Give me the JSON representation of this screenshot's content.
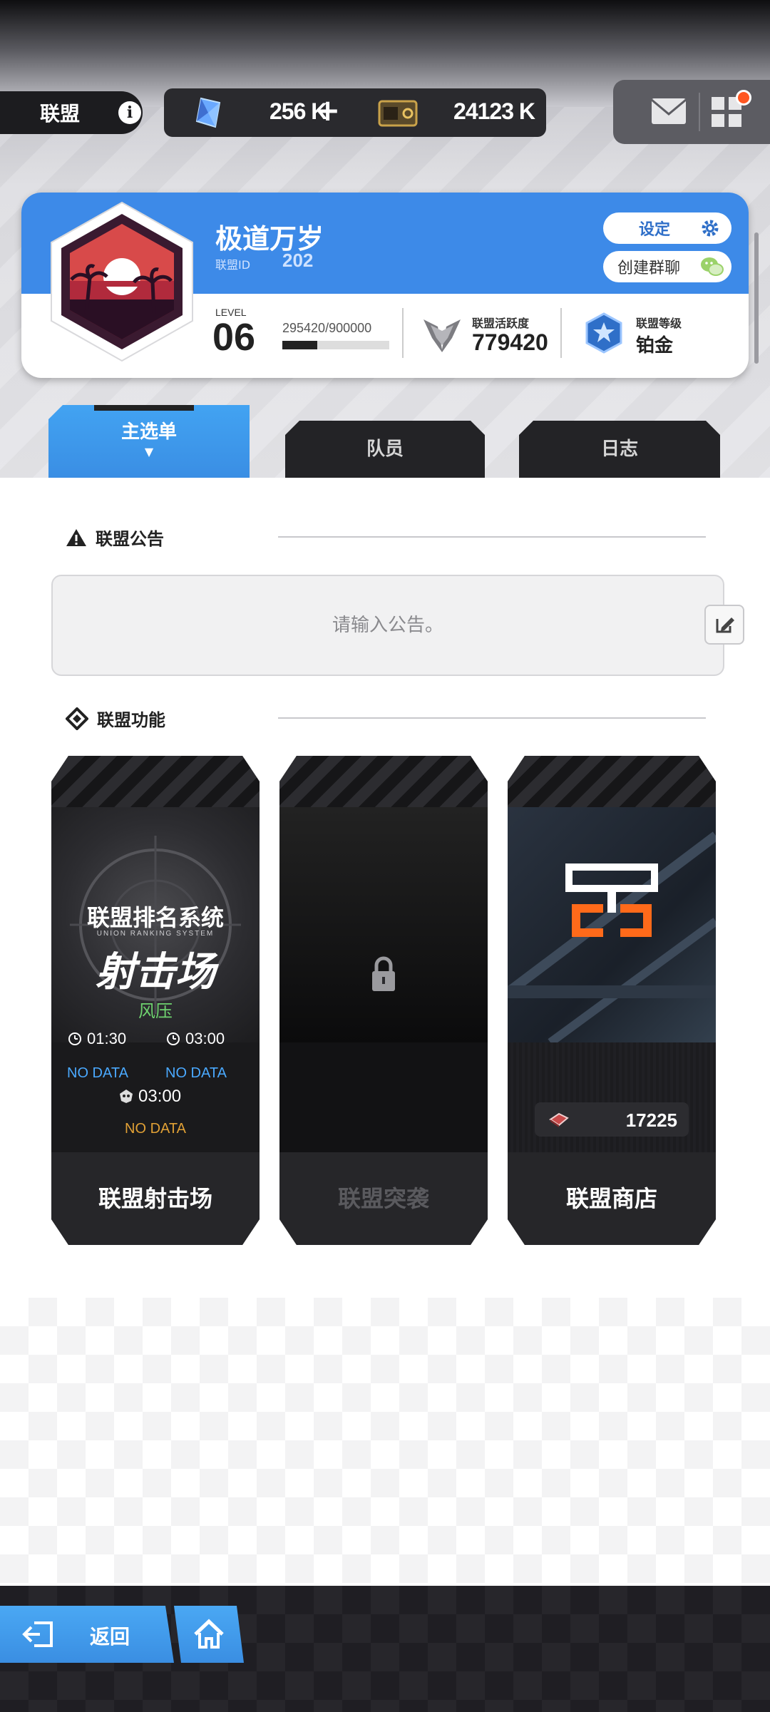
{
  "header": {
    "title": "联盟",
    "resource1_value": "256 K",
    "resource2_value": "24123 K",
    "plus_label": "+"
  },
  "union": {
    "name": "极道万岁",
    "id_label": "联盟ID",
    "id_value": "202",
    "settings_label": "设定",
    "group_chat_label": "创建群聊",
    "level_label": "LEVEL",
    "level_value": "06",
    "exp_text": "295420/900000",
    "exp_fraction": 0.328,
    "activity_label": "联盟活跃度",
    "activity_value": "779420",
    "rank_label": "联盟等级",
    "rank_value": "铂金"
  },
  "tabs": {
    "main": "主选单",
    "members": "队员",
    "log": "日志"
  },
  "notice": {
    "title": "联盟公告",
    "placeholder": "请输入公告。"
  },
  "features": {
    "title": "联盟功能",
    "shooting": {
      "art_title": "联盟排名系统",
      "art_subtitle": "UNION RANKING SYSTEM",
      "art_main": "射击场",
      "wind_label": "风压",
      "time1": "01:30",
      "time2": "03:00",
      "time3": "03:00",
      "nodata1": "NO DATA",
      "nodata2": "NO DATA",
      "nodata3": "NO DATA",
      "label": "联盟射击场"
    },
    "raid": {
      "label": "联盟突袭"
    },
    "shop": {
      "coin_value": "17225",
      "label": "联盟商店"
    }
  },
  "bottom": {
    "back_label": "返回"
  },
  "colors": {
    "accent_blue": "#3d8ae8",
    "notification": "#ff5722",
    "wind_green": "#6fd36f",
    "nodata_blue": "#4aa9ff",
    "nodata_orange": "#e0a035"
  }
}
